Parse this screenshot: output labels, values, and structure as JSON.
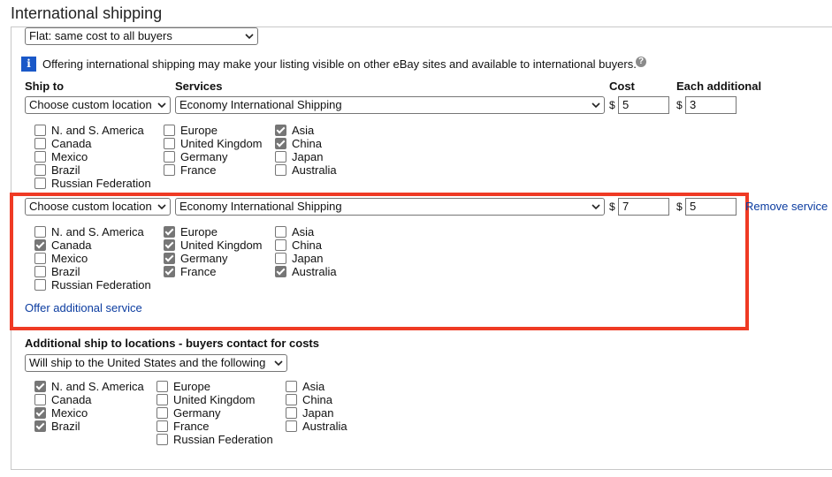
{
  "section_title": "International shipping",
  "shipping_type": "Flat: same cost to all buyers",
  "info_text": "Offering international shipping may make your listing visible on other eBay sites and available to international buyers.",
  "headers": {
    "ship_to": "Ship to",
    "services": "Services",
    "cost": "Cost",
    "each_additional": "Each additional"
  },
  "currency_symbol": "$",
  "services": [
    {
      "ship_to": "Choose custom location",
      "service": "Economy International Shipping",
      "cost": "5",
      "each_additional": "3",
      "regions": [
        {
          "label": "N. and S. America",
          "checked": false
        },
        {
          "label": "Canada",
          "checked": false
        },
        {
          "label": "Mexico",
          "checked": false
        },
        {
          "label": "Brazil",
          "checked": false
        },
        {
          "label": "Russian Federation",
          "checked": false
        },
        {
          "label": "Europe",
          "checked": false
        },
        {
          "label": "United Kingdom",
          "checked": false
        },
        {
          "label": "Germany",
          "checked": false
        },
        {
          "label": "France",
          "checked": false
        },
        {
          "label": "Asia",
          "checked": true
        },
        {
          "label": "China",
          "checked": true
        },
        {
          "label": "Japan",
          "checked": false
        },
        {
          "label": "Australia",
          "checked": false
        }
      ]
    },
    {
      "ship_to": "Choose custom location",
      "service": "Economy International Shipping",
      "cost": "7",
      "each_additional": "5",
      "remove_label": "Remove service",
      "regions": [
        {
          "label": "N. and S. America",
          "checked": false
        },
        {
          "label": "Canada",
          "checked": true
        },
        {
          "label": "Mexico",
          "checked": false
        },
        {
          "label": "Brazil",
          "checked": false
        },
        {
          "label": "Russian Federation",
          "checked": false
        },
        {
          "label": "Europe",
          "checked": true
        },
        {
          "label": "United Kingdom",
          "checked": true
        },
        {
          "label": "Germany",
          "checked": true
        },
        {
          "label": "France",
          "checked": true
        },
        {
          "label": "Asia",
          "checked": false
        },
        {
          "label": "China",
          "checked": false
        },
        {
          "label": "Japan",
          "checked": false
        },
        {
          "label": "Australia",
          "checked": true
        }
      ]
    }
  ],
  "offer_additional_label": "Offer additional service",
  "additional_locations": {
    "heading": "Additional ship to locations - buyers contact for costs",
    "select_value": "Will ship to the United States and the following",
    "regions": [
      {
        "label": "N. and S. America",
        "checked": true
      },
      {
        "label": "Canada",
        "checked": false
      },
      {
        "label": "Mexico",
        "checked": true
      },
      {
        "label": "Brazil",
        "checked": true
      },
      {
        "label": "Europe",
        "checked": false
      },
      {
        "label": "United Kingdom",
        "checked": false
      },
      {
        "label": "Germany",
        "checked": false
      },
      {
        "label": "France",
        "checked": false
      },
      {
        "label": "Russian Federation",
        "checked": false
      },
      {
        "label": "Asia",
        "checked": false
      },
      {
        "label": "China",
        "checked": false
      },
      {
        "label": "Japan",
        "checked": false
      },
      {
        "label": "Australia",
        "checked": false
      }
    ]
  },
  "icons": {
    "info": "info-icon",
    "help": "question-mark-icon",
    "dropdown": "chevron-down-icon"
  }
}
